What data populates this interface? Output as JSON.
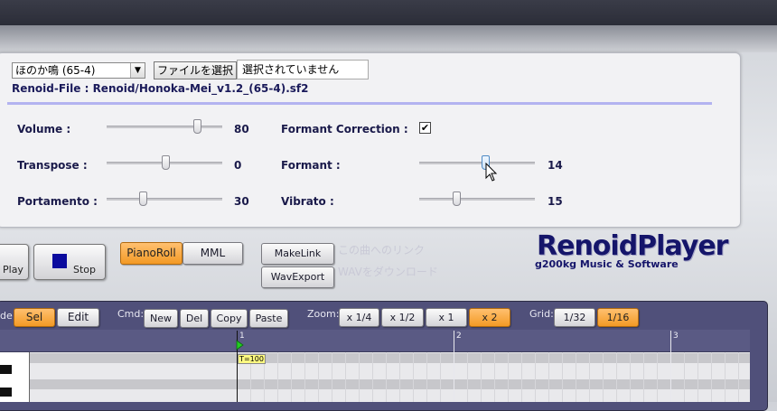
{
  "player": {
    "preset_select": "ほのか鳴 (65-4)",
    "file_button": "ファイルを選択",
    "file_status": "選択されていません",
    "renoid_file": "Renoid-File : Renoid/Honoka-Mei_v1.2_(65-4).sf2"
  },
  "controls": {
    "volume": {
      "label": "Volume :",
      "value": "80",
      "level": 0.8
    },
    "transpose": {
      "label": "Transpose :",
      "value": "0",
      "level": 0.5
    },
    "portamento": {
      "label": "Portamento :",
      "value": "30",
      "level": 0.3
    },
    "formant_correction": {
      "label": "Formant Correction :",
      "checked": true,
      "check_glyph": "✔"
    },
    "formant": {
      "label": "Formant :",
      "value": "14",
      "level": 0.57
    },
    "vibrato": {
      "label": "Vibrato :",
      "value": "15",
      "level": 0.3
    }
  },
  "transport": {
    "play_label": "Play",
    "stop_label": "Stop",
    "pianoroll_label": "PianoRoll",
    "mml_label": "MML",
    "makelink_label": "MakeLink",
    "wavexport_label": "WavExport",
    "makelink_hint": "この曲へのリンク",
    "wavexport_hint": "WAVをダウンロード"
  },
  "logo": {
    "title": "RenoidPlayer",
    "subtitle": "g200kg Music & Software"
  },
  "toolbar": {
    "mode_label": "de:",
    "sel": "Sel",
    "edit": "Edit",
    "cmd_label": "Cmd:",
    "new": "New",
    "del": "Del",
    "copy": "Copy",
    "paste": "Paste",
    "zoom_label": "Zoom:",
    "zoom_quarter": "x 1/4",
    "zoom_half": "x 1/2",
    "zoom_1": "x 1",
    "zoom_2": "x 2",
    "grid_label": "Grid:",
    "grid_32": "1/32",
    "grid_16": "1/16"
  },
  "roll": {
    "bars": [
      "1",
      "2",
      "3"
    ],
    "tempo_marker": "T=100"
  },
  "colors": {
    "accent_orange": "#f39a25",
    "editor_bg": "#50507a",
    "logo_navy": "#15156a"
  }
}
